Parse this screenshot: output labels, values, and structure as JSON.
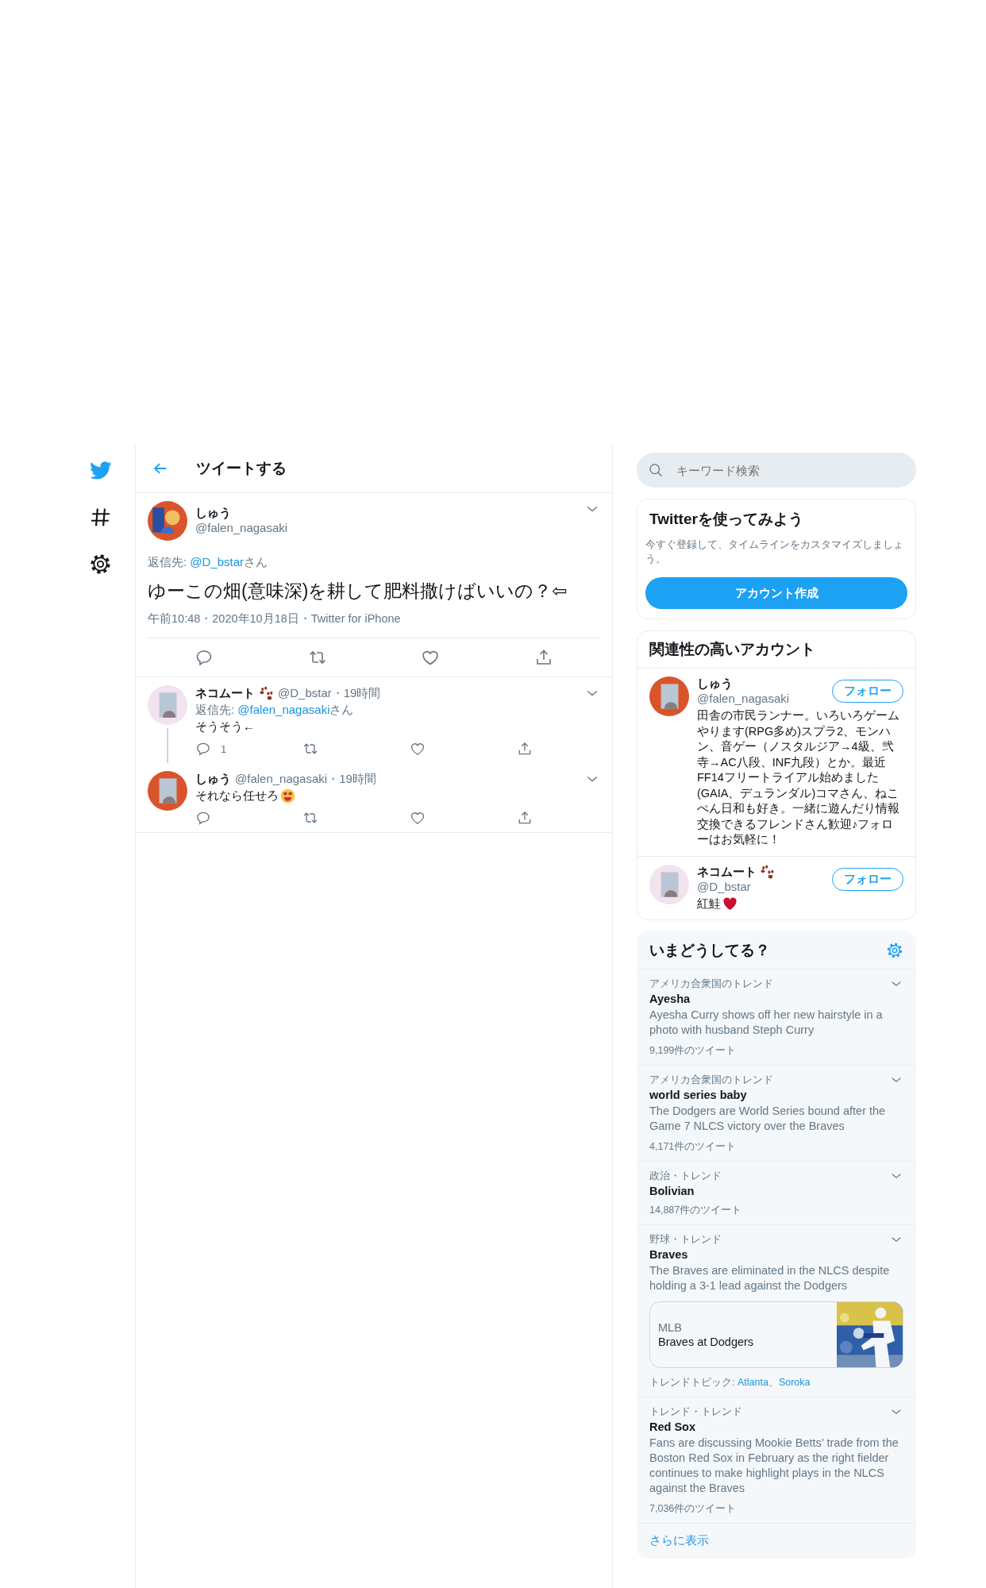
{
  "nav": {
    "items": [
      {
        "kind": "logo"
      },
      {
        "kind": "explore"
      },
      {
        "kind": "settings"
      }
    ]
  },
  "header": {
    "title": "ツイートする"
  },
  "tweet": {
    "avatar": {
      "color": "#d9542b"
    },
    "name": "しゅう",
    "handle": "@falen_nagasaki",
    "reply_label": "返信先: ",
    "reply_to": "@D_bstar",
    "reply_suffix": "さん",
    "text": "ゆーこの畑(意味深)を耕して肥料撒けばいいの？⇦",
    "meta": "午前10:48・2020年10月18日・Twitter for iPhone"
  },
  "replies": [
    {
      "avatar": {
        "color": "#f3e3ee"
      },
      "name": "ネコムート",
      "paw_emoji": true,
      "meta": "@D_bstar・19時間",
      "reply_label": "返信先: ",
      "reply_to": "@falen_nagasaki",
      "reply_suffix": "さん",
      "text": "そうそう←",
      "reply_count": "1",
      "thread": true
    },
    {
      "avatar": {
        "color": "#d9542b"
      },
      "name": "しゅう",
      "meta": "@falen_nagasaki・19時間",
      "text": "それなら任せろ",
      "heart_eyes_emoji": true
    }
  ],
  "search": {
    "placeholder": "キーワード検索"
  },
  "signup": {
    "title": "Twitterを使ってみよう",
    "text": "今すぐ登録して、タイムラインをカスタマイズしましょう。",
    "button": "アカウント作成"
  },
  "related": {
    "title": "関連性の高いアカウント",
    "accounts": [
      {
        "avatar": {
          "color": "#d9542b"
        },
        "name": "しゅう",
        "handle": "@falen_nagasaki",
        "follow": "フォロー",
        "bio": "田舎の市民ランナー。いろいろゲームやります(RPG多め)スプラ2、モンハン、音ゲー（ノスタルジア→4級、弐寺→AC八段、INF九段）とか。最近FF14フリートライアル始めました(GAIA、デュランダル)コマさん、ねこぺん日和も好き。一緒に遊んだり情報交換できるフレンドさん歓迎♪フォローはお気軽に！"
      },
      {
        "avatar": {
          "color": "#f3e3ee"
        },
        "name": "ネコムート",
        "paw_emoji": true,
        "handle": "@D_bstar",
        "follow": "フォロー",
        "bio": "紅鮭",
        "heart_emoji": true
      }
    ]
  },
  "trends": {
    "title": "いまどうしてる？",
    "items": [
      {
        "category": "アメリカ合衆国のトレンド",
        "title": "Ayesha",
        "description": "Ayesha Curry shows off her new hairstyle in a photo with husband Steph Curry",
        "count": "9,199件のツイート"
      },
      {
        "category": "アメリカ合衆国のトレンド",
        "title": "world series baby",
        "description": "The Dodgers are World Series bound after the Game 7 NLCS victory over the Braves",
        "count": "4,171件のツイート"
      },
      {
        "category": "政治・トレンド",
        "title": "Bolivian",
        "count": "14,887件のツイート"
      },
      {
        "category": "野球・トレンド",
        "title": "Braves",
        "description": "The Braves are eliminated in the NLCS despite holding a 3-1 lead against the Dodgers",
        "card": {
          "source": "MLB",
          "title": "Braves at Dodgers"
        },
        "topics_label": "トレンドトピック: ",
        "topics": [
          "Atlanta",
          "Soroka"
        ],
        "topics_separator": "、"
      },
      {
        "category": "トレンド・トレンド",
        "title": "Red Sox",
        "description": "Fans are discussing Mookie Betts’ trade from the Boston Red Sox in February as the right fielder continues to make highlight plays in the NLCS against the Braves",
        "count": "7,036件のツイート"
      }
    ],
    "more": "さらに表示"
  }
}
